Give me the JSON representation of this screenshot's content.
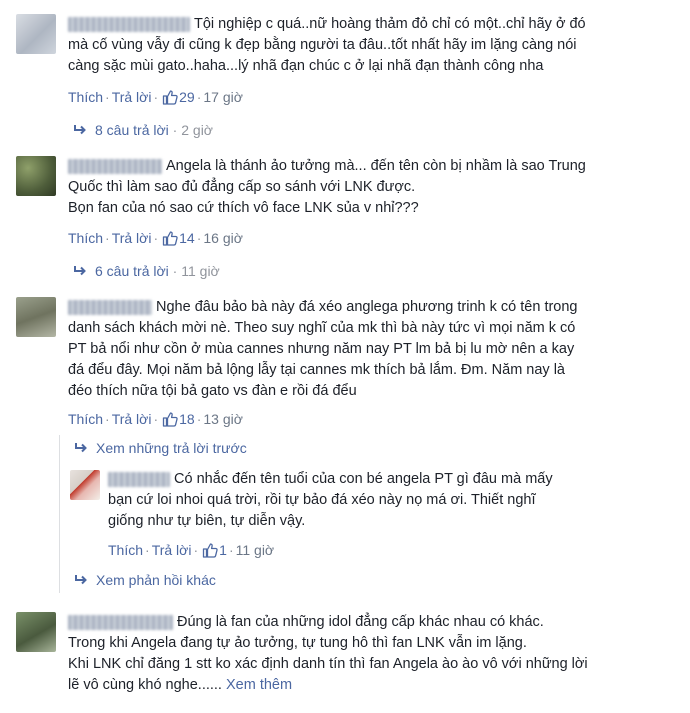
{
  "comments": [
    {
      "lines": [
        "Tội nghiệp c quá..nữ hoàng thảm đỏ chỉ có một..chỉ hãy ở đó",
        "mà cố vùng vẫy đi cũng k đẹp bằng người ta đâu..tốt nhất hãy im lặng càng nói",
        "càng sặc mùi gato..haha...lý nhã đạn chúc c ở lại nhã đạn thành công nha"
      ],
      "like": "Thích",
      "reply": "Trả lời",
      "likes": "29",
      "time": "17 giờ",
      "replies": "8 câu trả lời",
      "replies_time": "2 giờ"
    },
    {
      "lines": [
        "Angela là thánh ảo tưởng mà... đến tên còn bị nhầm là sao Trung",
        "Quốc thì làm sao đủ đẳng cấp so sánh với LNK được.",
        "Bọn fan của nó sao cứ thích vô face LNK sủa v nhỉ???"
      ],
      "like": "Thích",
      "reply": "Trả lời",
      "likes": "14",
      "time": "16 giờ",
      "replies": "6 câu trả lời",
      "replies_time": "11 giờ"
    },
    {
      "lines": [
        "Nghe đâu bảo bà này đá xéo anglega phương trinh k có tên trong",
        "danh sách khách mời nè. Theo suy nghĩ của mk thì bà này tức vì mọi năm k có",
        "PT bả nổi như cồn ở mùa cannes nhưng năm nay PT lm bả bị lu mờ nên a kay",
        "đá đểu đây. Mọi năm bả lộng lẫy tại cannes mk thích bả lắm. Đm. Năm nay là",
        "đéo thích nữa tội bả gato vs đàn e rồi đá đểu"
      ],
      "like": "Thích",
      "reply": "Trả lời",
      "likes": "18",
      "time": "13 giờ",
      "prev_replies": "Xem những trả lời trước",
      "nested": {
        "lines": [
          "Có nhắc đến tên tuổi của con bé angela PT gì đâu mà mấy",
          "bạn cứ loi nhoi quá trời, rồi tự bảo đá xéo này nọ má ơi. Thiết nghĩ",
          "giống như tự biên, tự diễn vậy."
        ],
        "like": "Thích",
        "reply": "Trả lời",
        "likes": "1",
        "time": "11 giờ"
      },
      "more_replies": "Xem phản hồi khác"
    },
    {
      "lines": [
        "Đúng là fan của những idol đẳng cấp khác nhau có khác.",
        "Trong khi Angela đang tự ảo tưởng, tự tung hô thì fan LNK vẫn im lặng.",
        "Khi LNK chỉ đăng 1 stt ko xác định danh tín thì fan Angela ào ào vô với những lời",
        "lẽ vô cùng khó nghe......"
      ],
      "see_more": "Xem thêm"
    }
  ]
}
